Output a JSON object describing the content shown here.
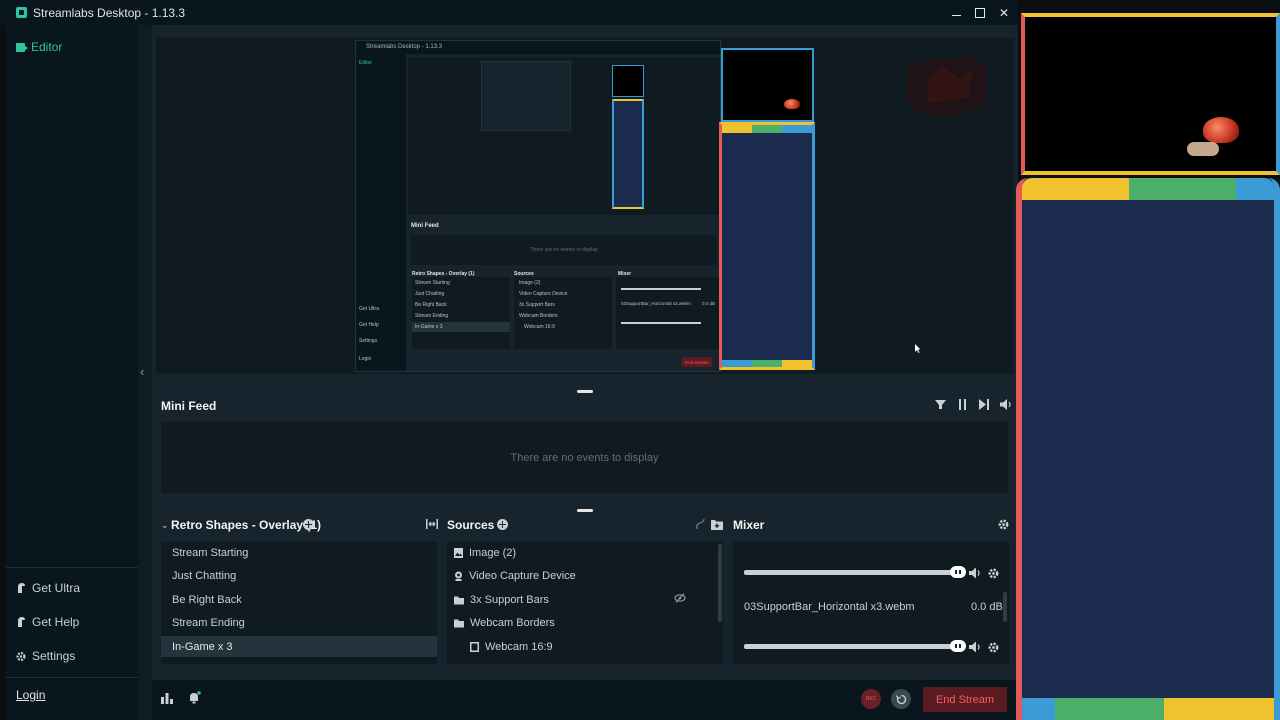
{
  "window": {
    "title": "Streamlabs Desktop - 1.13.3"
  },
  "sidebar": {
    "editor": "Editor",
    "bottom": [
      {
        "label": "Get Ultra"
      },
      {
        "label": "Get Help"
      },
      {
        "label": "Settings"
      }
    ],
    "login": "Login"
  },
  "nested_preview": {
    "title": "Streamlabs Desktop - 1.13.3",
    "editor": "Editor",
    "mini_feed": "Mini Feed",
    "no_events": "There are no events to display",
    "scenes_title": "Retro Shapes - Overlay (1)",
    "sources_title": "Sources",
    "mixer_title": "Mixer",
    "scenes": [
      "Stream Starting",
      "Just Chatting",
      "Be Right Back",
      "Stream Ending",
      "In-Game x 3"
    ],
    "sources": [
      "Image (2)",
      "Video Capture Device",
      "3x Support Bars",
      "Webcam Borders",
      "Webcam 16:9"
    ],
    "mixer_source": "03SupportBar_Horizontal x3.webm",
    "mixer_db": "0.0 dB",
    "sidebar": [
      "Get Ultra",
      "Get Help",
      "Settings",
      "Login"
    ],
    "end_stream": "End Stream"
  },
  "mini_feed": {
    "title": "Mini Feed",
    "empty_text": "There are no events to display"
  },
  "scenes": {
    "title": "Retro Shapes - Overlay (1)",
    "items": [
      "Stream Starting",
      "Just Chatting",
      "Be Right Back",
      "Stream Ending",
      "In-Game x 3"
    ],
    "selected": "In-Game x 3"
  },
  "sources": {
    "title": "Sources",
    "items": [
      {
        "label": "Image (2)",
        "icon": "image-icon"
      },
      {
        "label": "Video Capture Device",
        "icon": "webcam-icon"
      },
      {
        "label": "3x Support Bars",
        "icon": "folder-icon"
      },
      {
        "label": "Webcam Borders",
        "icon": "folder-icon"
      },
      {
        "label": "Webcam 16:9",
        "icon": "image-icon"
      }
    ]
  },
  "mixer": {
    "title": "Mixer",
    "source_name": "03SupportBar_Horizontal x3.webm",
    "db": "0.0 dB",
    "levels": [
      1.0,
      1.0
    ]
  },
  "footer": {
    "rec": "REC",
    "end_stream": "End Stream"
  },
  "colors": {
    "accent": "#31c3a2",
    "red": "#e25a5a",
    "yellow": "#f0c22f",
    "green": "#4caf6a",
    "blue": "#3a9bd5",
    "navy": "#1a2b4d"
  }
}
